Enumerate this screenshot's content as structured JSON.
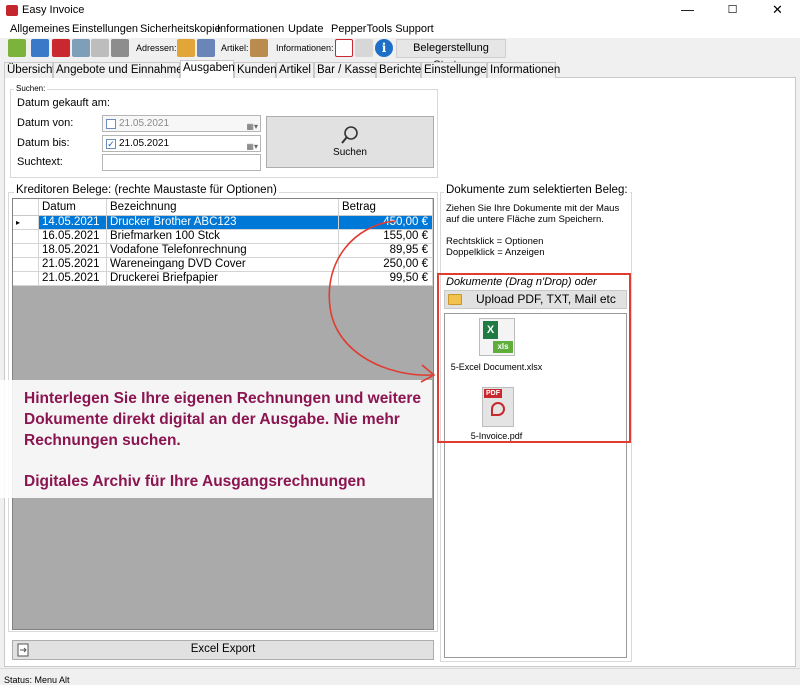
{
  "window": {
    "title": "Easy Invoice",
    "minimize": "—",
    "maximize": "☐",
    "close": "✕"
  },
  "menu": [
    "Allgemeines",
    "Einstellungen",
    "Sicherheitskopie",
    "Informationen",
    "Update",
    "PepperTools Support"
  ],
  "toolbar": {
    "adressen_label": "Adressen:",
    "artikel_label": "Artikel:",
    "informationen_label": "Informationen:",
    "start_button": "Belegerstellung Starten"
  },
  "tabs": [
    "Übersicht",
    "Angebote und Einnahmen",
    "Ausgaben",
    "Kunden",
    "Artikel",
    "Bar / Kasse",
    "Berichte",
    "Einstellungen",
    "Informationen"
  ],
  "active_tab": "Ausgaben",
  "search": {
    "group_label": "Suchen:",
    "datum_gekauft_am": "Datum gekauft am:",
    "datum_von_label": "Datum von:",
    "datum_von_value": "21.05.2021",
    "datum_bis_label": "Datum bis:",
    "datum_bis_value": "21.05.2021",
    "suchtext_label": "Suchtext:",
    "suchtext_value": "",
    "search_button": "Suchen"
  },
  "grid": {
    "group_label": "Kreditoren Belege: (rechte Maustaste für Optionen)",
    "columns": [
      "Datum",
      "Bezeichnung",
      "Betrag"
    ],
    "rows": [
      {
        "datum": "14.05.2021",
        "bezeichnung": "Drucker Brother ABC123",
        "betrag": "450,00 €"
      },
      {
        "datum": "16.05.2021",
        "bezeichnung": "Briefmarken 100 Stck",
        "betrag": "155,00 €"
      },
      {
        "datum": "18.05.2021",
        "bezeichnung": "Vodafone Telefonrechnung",
        "betrag": "89,95 €"
      },
      {
        "datum": "21.05.2021",
        "bezeichnung": "Wareneingang DVD Cover",
        "betrag": "250,00 €"
      },
      {
        "datum": "21.05.2021",
        "bezeichnung": "Druckerei Briefpapier",
        "betrag": "99,50 €"
      }
    ],
    "excel_export": "Excel Export"
  },
  "documents": {
    "group_label": "Dokumente zum selektierten Beleg:",
    "hint_line1": "Ziehen Sie Ihre Dokumente mit der Maus",
    "hint_line2": "auf die untere Fläche zum Speichern.",
    "hint_line3": "Rechtsklick = Optionen",
    "hint_line4": "Doppelklick = Anzeigen",
    "dragdrop_label": "Dokumente (Drag n'Drop) oder",
    "upload_button": "Upload PDF, TXT, Mail etc",
    "files": [
      {
        "name": "5-Excel Document.xlsx",
        "icon": "excel-file-icon",
        "badge": "xls"
      },
      {
        "name": "5-Invoice.pdf",
        "icon": "pdf-file-icon",
        "badge": "PDF"
      }
    ]
  },
  "banner": {
    "line1": "Hinterlegen Sie Ihre eigenen Rechnungen und weitere",
    "line2": "Dokumente direkt digital an der Ausgabe. Nie mehr",
    "line3": "Rechnungen suchen.",
    "line4": "Digitales Archiv für Ihre Ausgangsrechnungen"
  },
  "status": {
    "text": "Status: Menu Alt"
  },
  "colors": {
    "selection": "#0078d7",
    "banner_text": "#8b1550",
    "highlight_frame": "#e03c31"
  }
}
